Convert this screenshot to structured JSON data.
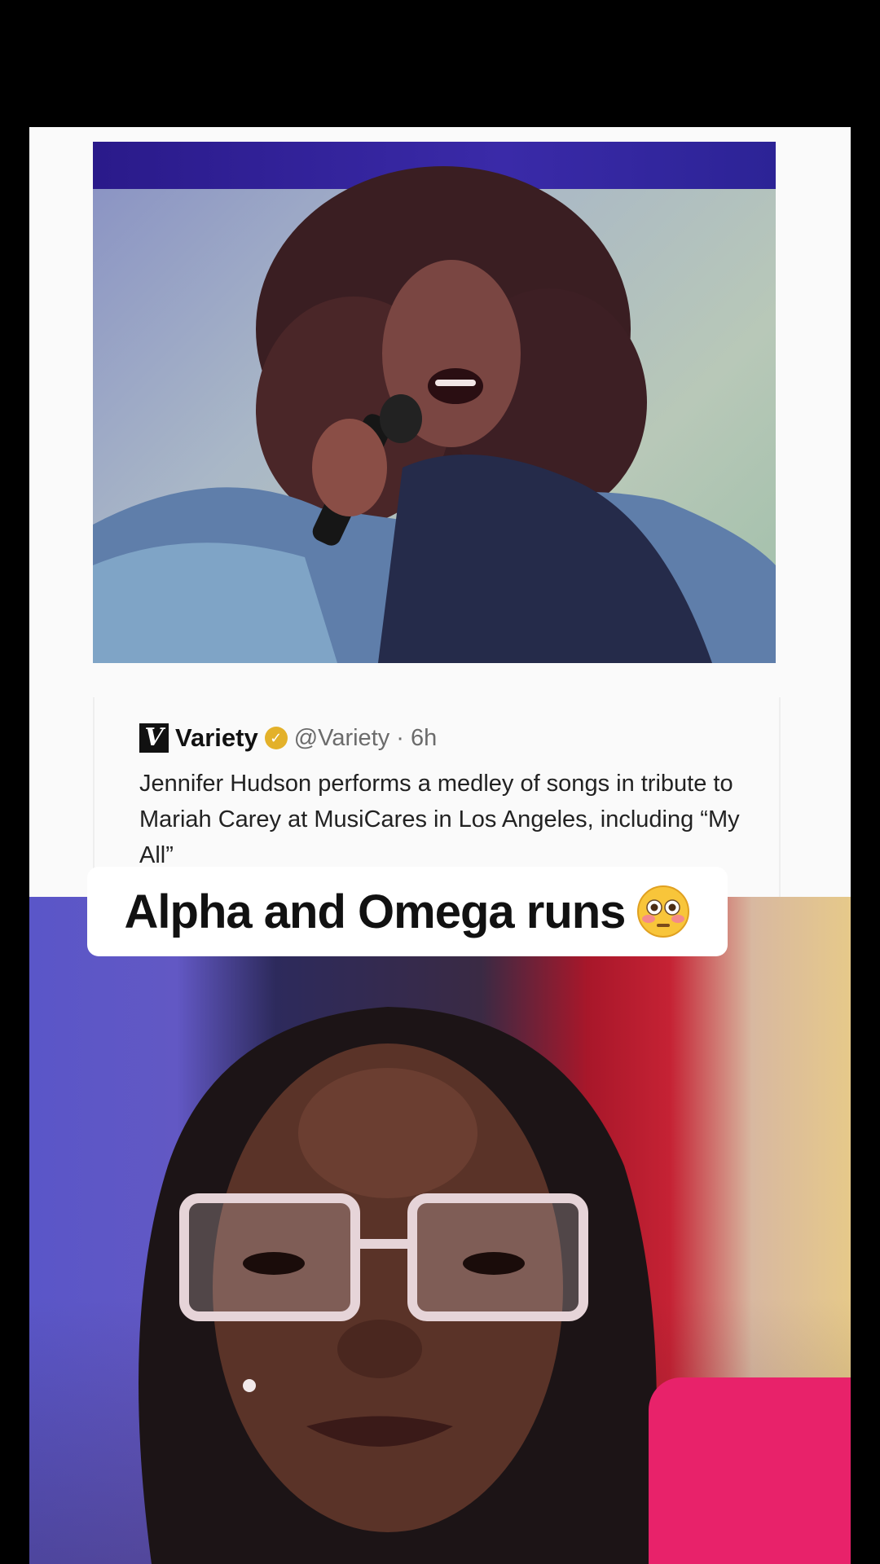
{
  "tweet": {
    "account_name": "Variety",
    "handle_time": "@Variety · 6h",
    "text": "Jennifer Hudson performs a medley of songs in tribute to Mariah Carey at MusiCares in Los Angeles, including “My All”"
  },
  "caption": {
    "text": "Alpha and Omega runs",
    "emoji": "flushed-face-emoji"
  },
  "colors": {
    "background": "#000000",
    "card": "#fafafa",
    "verified_badge": "#e3b12a",
    "caption_bg": "#ffffff"
  }
}
